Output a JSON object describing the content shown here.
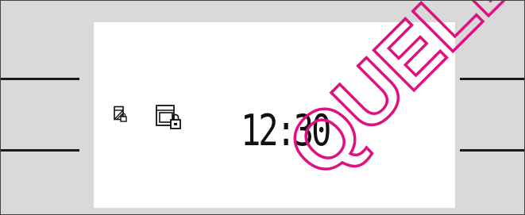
{
  "display": {
    "time": "12:30",
    "icons": [
      "childlock-door-icon",
      "oven-lock-icon"
    ]
  },
  "watermark": {
    "text": "QUELLE",
    "color": "#e0117f"
  },
  "colors": {
    "panel_bg": "#d9d9d9",
    "display_bg": "#ffffff",
    "segments": "#111111",
    "watermark": "#e0117f"
  }
}
